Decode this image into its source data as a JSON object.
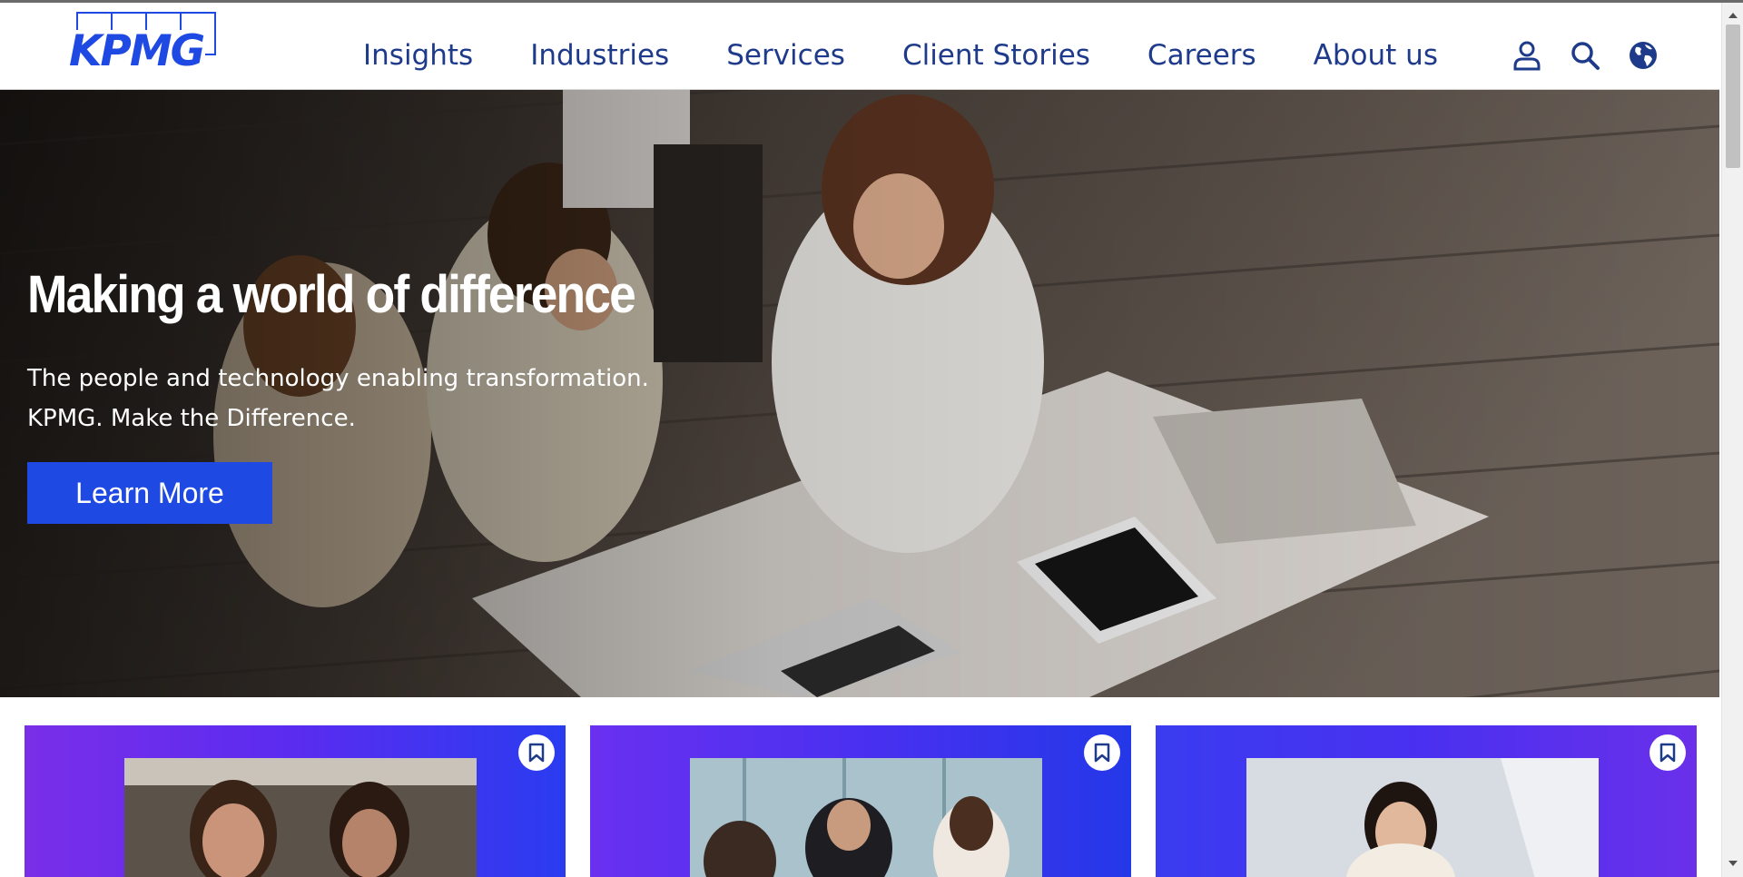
{
  "header": {
    "logo_text": "KPMG",
    "nav": [
      {
        "label": "Insights"
      },
      {
        "label": "Industries"
      },
      {
        "label": "Services"
      },
      {
        "label": "Client Stories"
      },
      {
        "label": "Careers"
      },
      {
        "label": "About us"
      }
    ],
    "icons": [
      "user-icon",
      "search-icon",
      "globe-icon"
    ]
  },
  "hero": {
    "title": "Making a world of difference",
    "subtitle_line1": "The people and technology enabling transformation.",
    "subtitle_line2": "KPMG. Make the Difference.",
    "button_label": "Learn More"
  },
  "cards": [
    {
      "bookmark_icon": "bookmark-icon"
    },
    {
      "bookmark_icon": "bookmark-icon"
    },
    {
      "bookmark_icon": "bookmark-icon"
    }
  ],
  "colors": {
    "brand_blue": "#1e49e2",
    "nav_text": "#1e3a8a",
    "card_purple": "#6a2cf0"
  }
}
